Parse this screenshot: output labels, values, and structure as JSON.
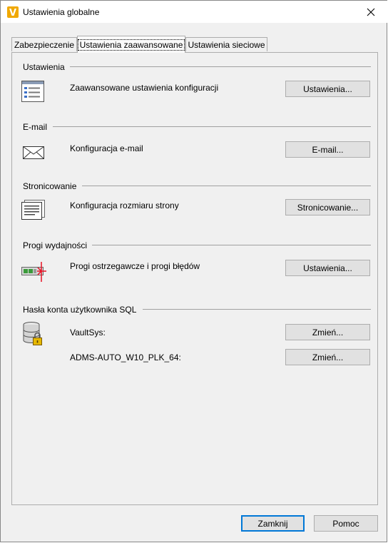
{
  "window": {
    "title": "Ustawienia globalne",
    "app_icon_letter": "V"
  },
  "tabs": [
    {
      "label": "Zabezpieczenie"
    },
    {
      "label": "Ustawienia zaawansowane"
    },
    {
      "label": "Ustawienia sieciowe"
    }
  ],
  "sections": {
    "settings": {
      "title": "Ustawienia",
      "description": "Zaawansowane ustawienia konfiguracji",
      "button": "Ustawienia..."
    },
    "email": {
      "title": "E-mail",
      "description": "Konfiguracja e-mail",
      "button": "E-mail..."
    },
    "paging": {
      "title": "Stronicowanie",
      "description": "Konfiguracja rozmiaru strony",
      "button": "Stronicowanie..."
    },
    "performance": {
      "title": "Progi wydajności",
      "description": "Progi ostrzegawcze i progi błędów",
      "button": "Ustawienia..."
    },
    "sql": {
      "title": "Hasła konta użytkownika SQL",
      "accounts": [
        {
          "label": "VaultSys:",
          "button": "Zmień..."
        },
        {
          "label": "ADMS-AUTO_W10_PLK_64:",
          "button": "Zmień..."
        }
      ]
    }
  },
  "footer": {
    "close": "Zamknij",
    "help": "Pomoc"
  },
  "colors": {
    "accent": "#0078d7",
    "app_icon": "#f0a800",
    "threshold_red": "#e81123",
    "threshold_green": "#3a9a3a"
  }
}
